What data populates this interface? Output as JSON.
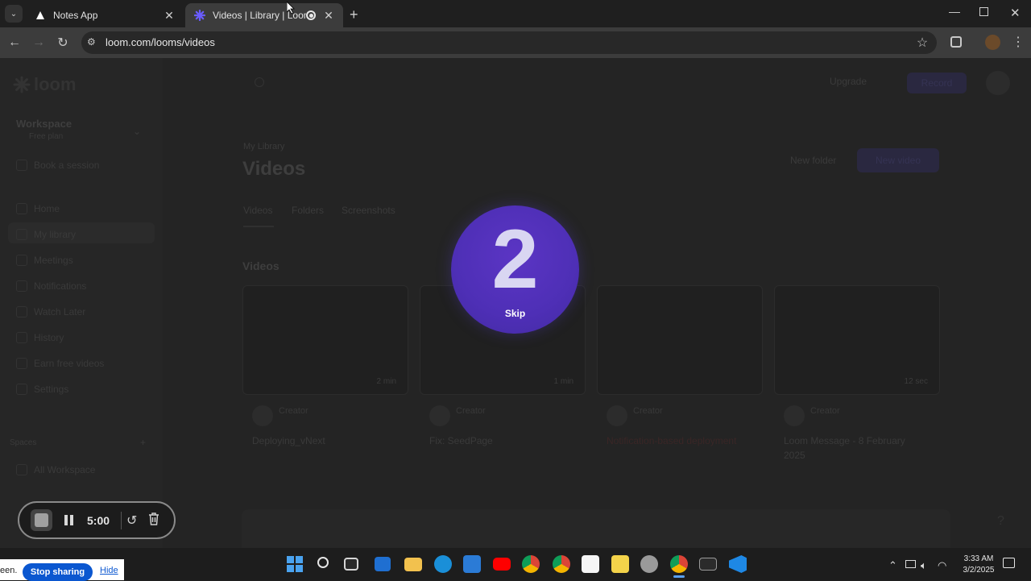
{
  "browser": {
    "tabs": [
      {
        "title": "Notes App",
        "active": false
      },
      {
        "title": "Videos | Library | Loom",
        "active": true
      }
    ],
    "url": "loom.com/looms/videos"
  },
  "loom_page": {
    "brand": "loom",
    "workspace": "Workspace",
    "workspace_sub": "Free plan",
    "book_button": "Book a session",
    "nav_items": [
      "Home",
      "My library",
      "Meetings",
      "Notifications",
      "Watch Later",
      "History",
      "Earn free videos",
      "Settings"
    ],
    "spaces_header": "Spaces",
    "space_item": "All Workspace",
    "header_upgrade": "Upgrade",
    "header_new": "Record",
    "breadcrumb": "My Library",
    "page_title": "Videos",
    "tabs": [
      "Videos",
      "Folders",
      "Screenshots"
    ],
    "section_title": "Videos",
    "new_folder": "New folder",
    "new_video": "New video",
    "videos": [
      {
        "title": "Deploying_vNext",
        "author": "Creator",
        "duration": "2 min"
      },
      {
        "title": "Fix: SeedPage",
        "author": "Creator",
        "duration": "1 min"
      },
      {
        "title": "Notification-based deployment",
        "author": "Creator",
        "duration": ""
      },
      {
        "title": "Loom Message - 8 February 2025",
        "author": "Creator",
        "duration": "12 sec"
      }
    ]
  },
  "countdown": {
    "number": "2",
    "skip_label": "Skip"
  },
  "recording_controls": {
    "time": "5:00"
  },
  "sharing_bar": {
    "text": "een.",
    "stop_label": "Stop sharing",
    "hide_label": "Hide"
  },
  "taskbar": {
    "time": "3:33 AM",
    "date": "3/2/2025"
  }
}
